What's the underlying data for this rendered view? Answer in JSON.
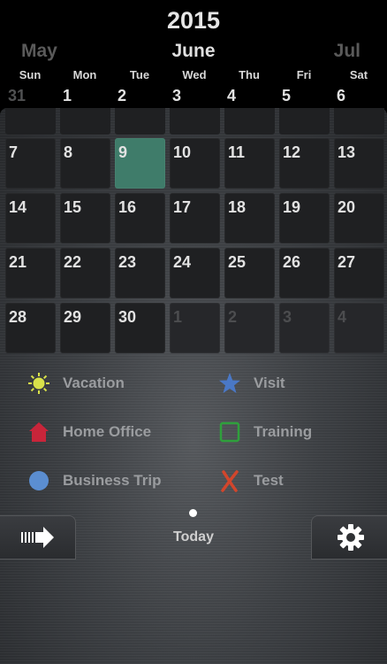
{
  "header": {
    "year": "2015",
    "prev_month": "May",
    "current_month": "June",
    "next_month": "Jul"
  },
  "weekdays": [
    "Sun",
    "Mon",
    "Tue",
    "Wed",
    "Thu",
    "Fri",
    "Sat"
  ],
  "first_row": [
    "31",
    "1",
    "2",
    "3",
    "4",
    "5",
    "6"
  ],
  "calendar": {
    "rows": [
      [
        "7",
        "8",
        "9",
        "10",
        "11",
        "12",
        "13"
      ],
      [
        "14",
        "15",
        "16",
        "17",
        "18",
        "19",
        "20"
      ],
      [
        "21",
        "22",
        "23",
        "24",
        "25",
        "26",
        "27"
      ],
      [
        "28",
        "29",
        "30",
        "1",
        "2",
        "3",
        "4"
      ]
    ],
    "today": "9",
    "today_color": "#3f7c6a"
  },
  "legend": [
    {
      "label": "Vacation",
      "icon": "sun-icon",
      "color": "#d9e24a"
    },
    {
      "label": "Visit",
      "icon": "star-icon",
      "color": "#4a78c6"
    },
    {
      "label": "Home Office",
      "icon": "house-icon",
      "color": "#c8253a"
    },
    {
      "label": "Training",
      "icon": "square-outline-icon",
      "color": "#2fa03c"
    },
    {
      "label": "Business Trip",
      "icon": "circle-icon",
      "color": "#5b8ed1"
    },
    {
      "label": "Test",
      "icon": "cross-icon",
      "color": "#d2462c"
    }
  ],
  "footer": {
    "today_label": "Today",
    "left_icon": "forward-arrow-icon",
    "right_icon": "gear-icon"
  }
}
